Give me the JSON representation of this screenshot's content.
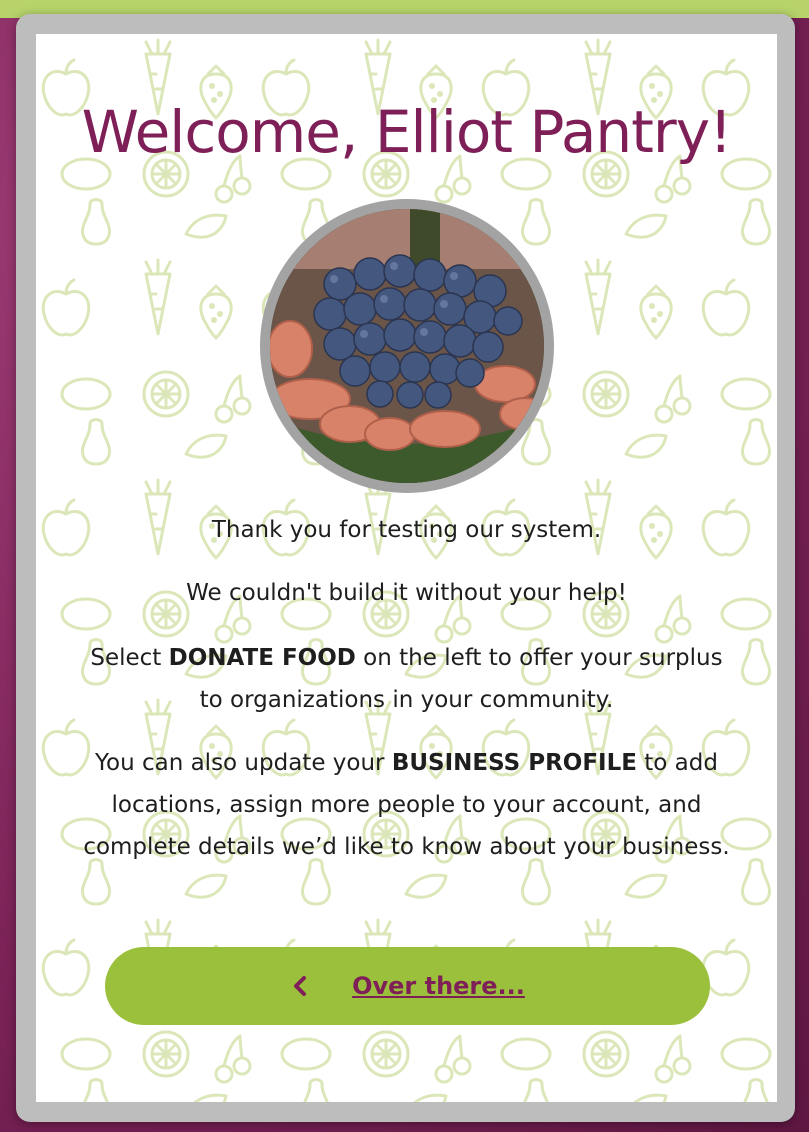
{
  "colors": {
    "accent": "#7e1f58",
    "button_bg": "#9bc13c",
    "pattern": "#dbe7b8",
    "frame": "#bdbdbd"
  },
  "modal": {
    "title": "Welcome, Elliot Pantry!",
    "image": "grapes-in-hands-photo",
    "line1": "Thank you for testing our system.",
    "line2": "We couldn't build it without your help!",
    "line3_pre": "Select ",
    "line3_bold": "DONATE FOOD",
    "line3_post": " on the left to offer your surplus to organizations in your community.",
    "line4_pre": "You can also update your ",
    "line4_bold": "BUSINESS PROFILE",
    "line4_post": " to add locations, assign more people to your account, and complete details we’d like to know about your business.",
    "button_icon": "chevron-left-icon",
    "button_label": "Over there..."
  }
}
